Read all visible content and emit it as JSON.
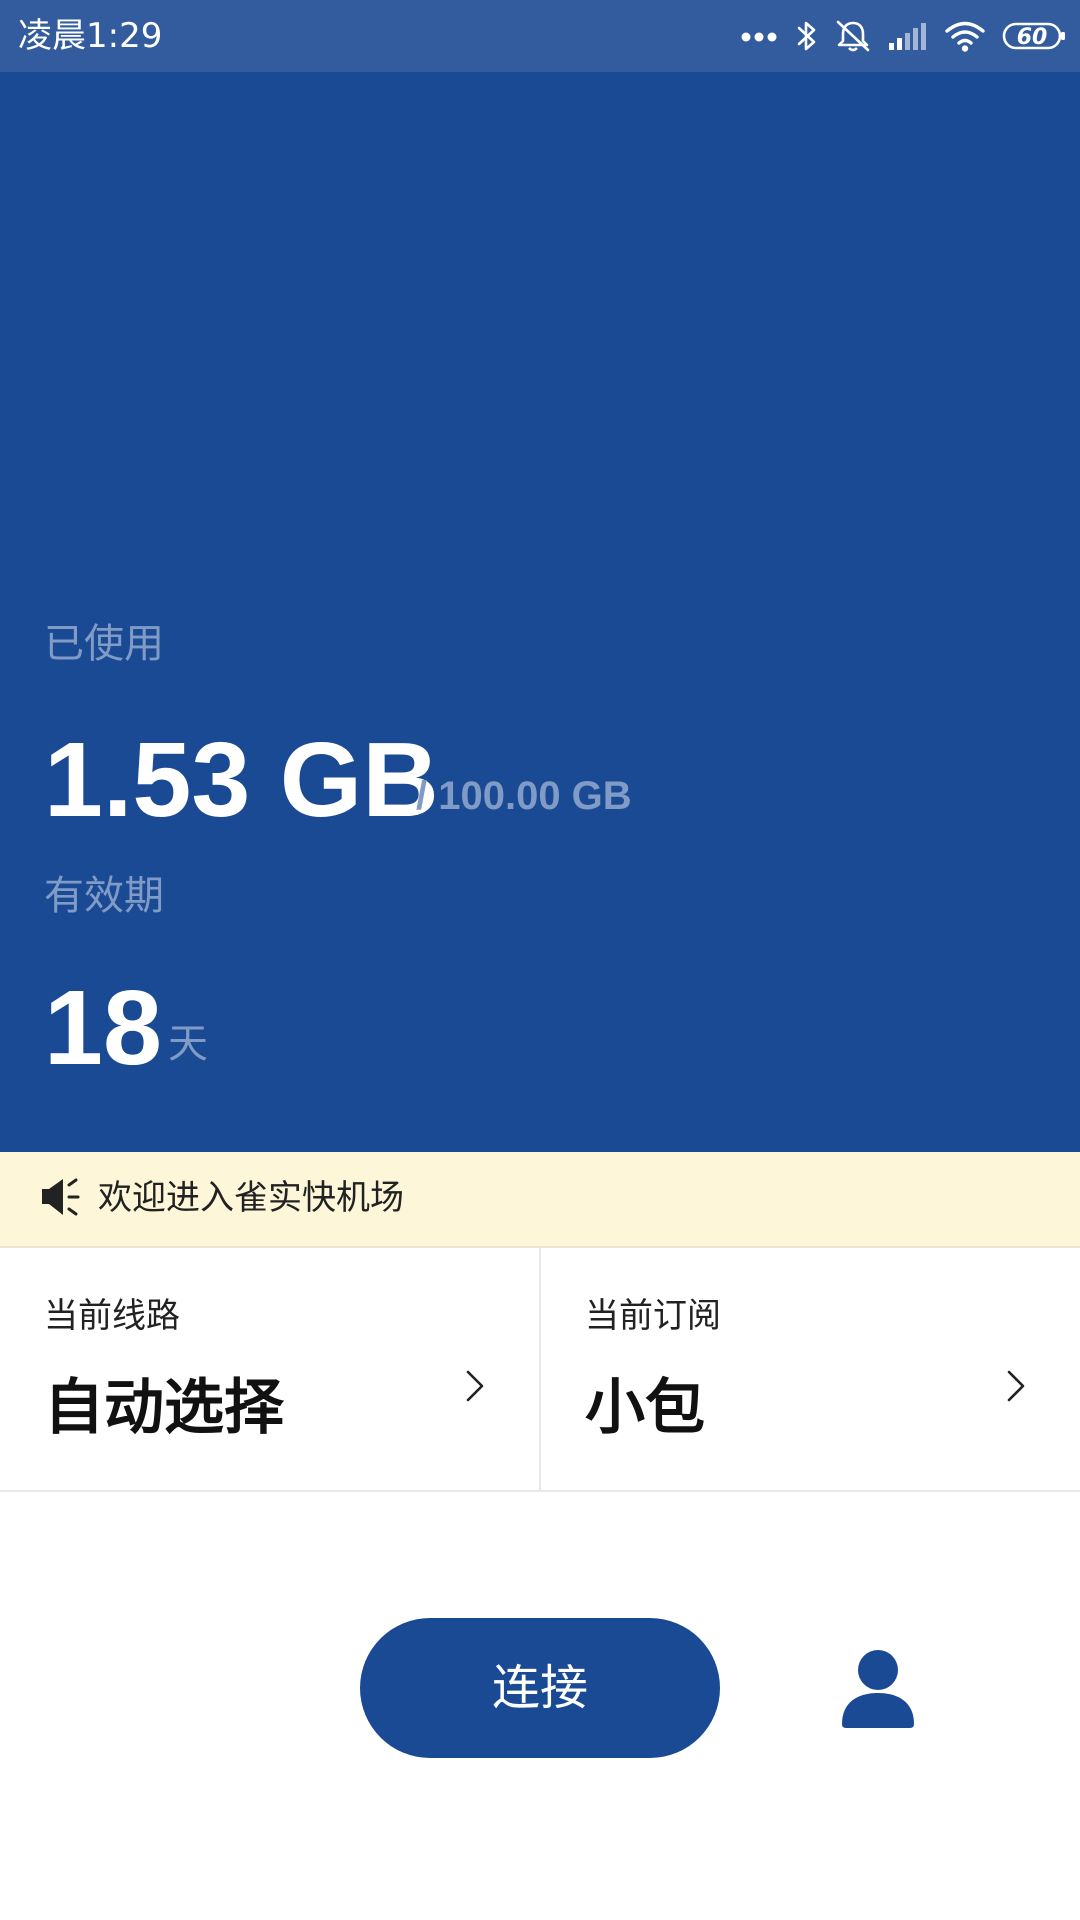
{
  "status_bar": {
    "time": "凌晨1:29",
    "battery_level": "60",
    "icons": [
      "more-dots-icon",
      "bluetooth-icon",
      "bell-off-icon",
      "cell-signal-icon",
      "wifi-icon",
      "battery-icon"
    ]
  },
  "usage": {
    "used_label": "已使用",
    "used_value": "1.53 GB",
    "total_value": "/ 100.00 GB",
    "validity_label": "有效期",
    "days_value": "18",
    "days_unit": "天"
  },
  "notice": {
    "icon": "megaphone-icon",
    "text": "欢迎进入雀实快机场"
  },
  "cards": {
    "route": {
      "label": "当前线路",
      "value": "自动选择",
      "icon": "chevron-right-icon"
    },
    "subscription": {
      "label": "当前订阅",
      "value": "小包",
      "icon": "chevron-right-icon"
    }
  },
  "actions": {
    "connect_label": "连接",
    "profile_icon": "user-icon"
  },
  "colors": {
    "status_bar": "#335c9f",
    "primary": "#1b4a94",
    "muted_text": "#7f9bc6",
    "notice_bg": "#fdf6d9"
  }
}
